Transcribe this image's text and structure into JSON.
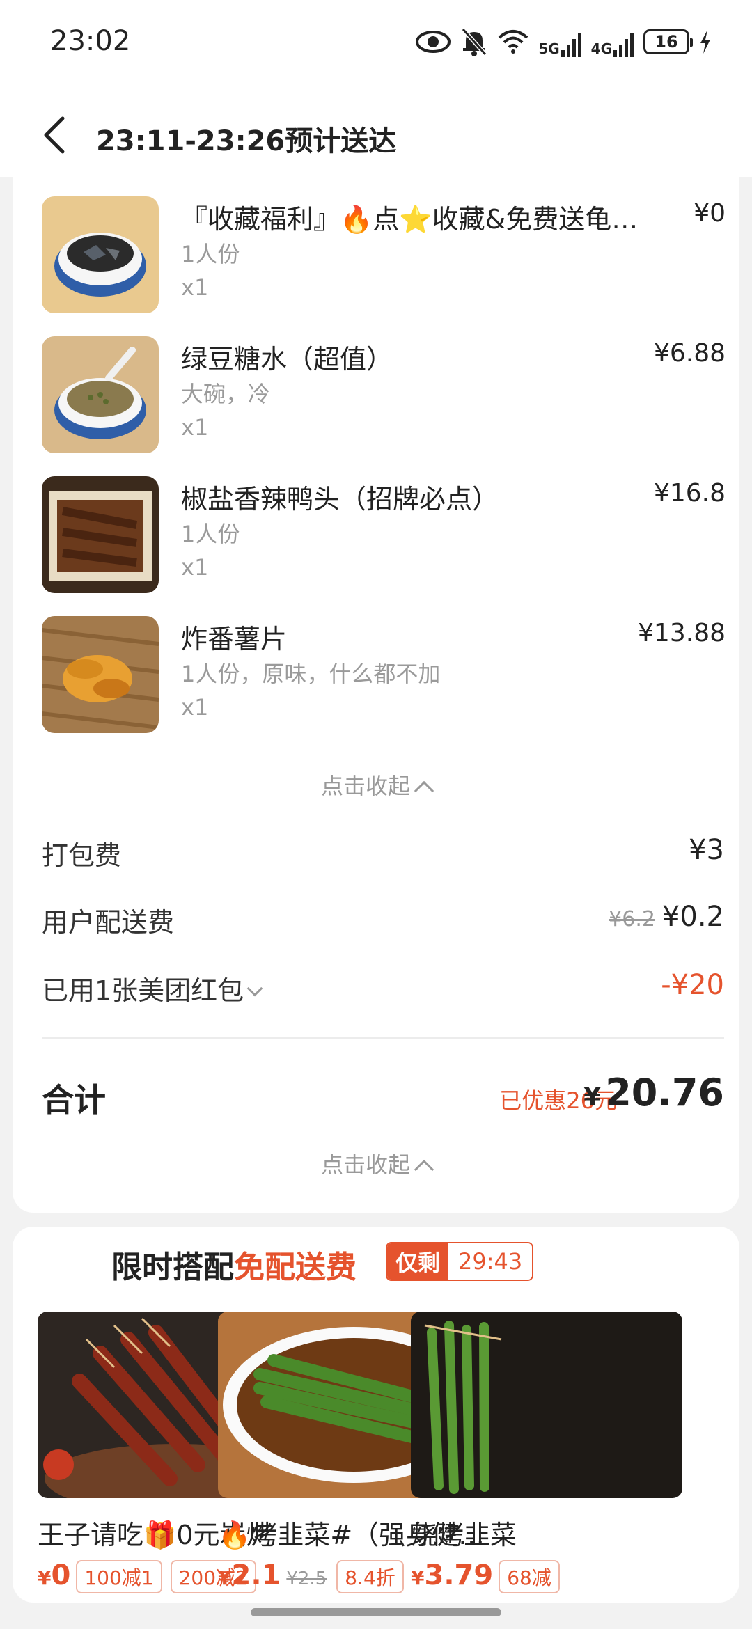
{
  "status_bar": {
    "time": "23:02",
    "icons": [
      "eye-icon",
      "bell-off-icon",
      "wifi-icon",
      "signal-5g-icon",
      "signal-4g-icon",
      "battery-icon",
      "charging-icon"
    ],
    "net1": "5G",
    "net2": "4G",
    "battery": "16"
  },
  "header": {
    "title": "23:11-23:26预计送达"
  },
  "items": [
    {
      "name": "『收藏福利』🔥点⭐收藏&免费送龟苓膏",
      "spec": "1人份",
      "qty": "x1",
      "price": "¥0"
    },
    {
      "name": "绿豆糖水（超值）",
      "spec": "大碗，冷",
      "qty": "x1",
      "price": "¥6.88"
    },
    {
      "name": "椒盐香辣鸭头（招牌必点）",
      "spec": "1人份",
      "qty": "x1",
      "price": "¥16.8"
    },
    {
      "name": "炸番薯片",
      "spec": "1人份，原味，什么都不加",
      "qty": "x1",
      "price": "¥13.88"
    }
  ],
  "collapse_label": "点击收起",
  "fees": {
    "packing_label": "打包费",
    "packing_value": "¥3",
    "delivery_label": "用户配送费",
    "delivery_original": "¥6.2",
    "delivery_value": "¥0.2",
    "coupon_label": "已用1张美团红包",
    "coupon_value": "-¥20"
  },
  "total": {
    "label": "合计",
    "saved": "已优惠26元",
    "currency": "¥",
    "value": "20.76"
  },
  "promo": {
    "title_prefix": "限时搭配",
    "title_highlight": "免配送费",
    "timer_label": "仅剩",
    "timer_value": "29:43",
    "products": [
      {
        "name": "王子请吃🎁0元炭烤",
        "currency": "¥",
        "price": "0",
        "original": "",
        "tags": [
          "100减1",
          "200减2"
        ]
      },
      {
        "name": "🔥烤韭菜#（强身健体）",
        "currency": "¥",
        "price": "2.1",
        "original": "¥2.5",
        "tags": [
          "8.4折"
        ]
      },
      {
        "name": "烧烤韭菜",
        "currency": "¥",
        "price": "3.79",
        "original": "",
        "tags": [
          "68减"
        ]
      }
    ]
  },
  "colors": {
    "accent": "#e5532d",
    "text": "#222222",
    "muted": "#9a9a9a",
    "background": "#f2f2f2"
  }
}
